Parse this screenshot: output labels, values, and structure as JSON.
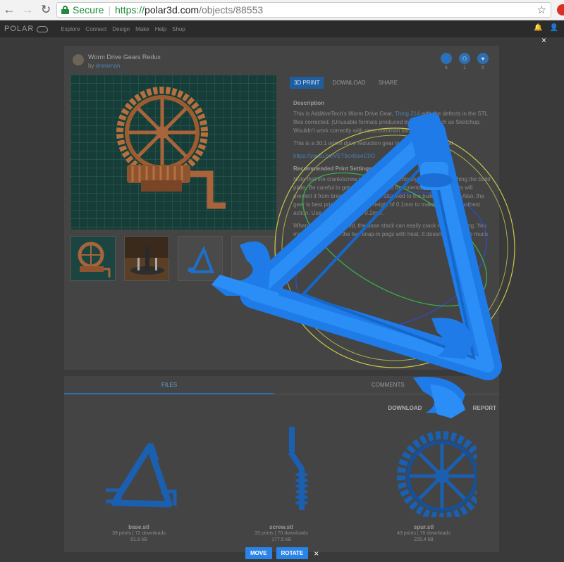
{
  "browser": {
    "back": "←",
    "forward": "→",
    "reload": "↻",
    "secure_label": "Secure",
    "url_scheme": "https://",
    "url_host": "polar3d.com",
    "url_path": "/objects/88553",
    "star": "☆"
  },
  "site": {
    "logo_text": "POLAR",
    "nav": [
      "Explore",
      "Connect",
      "Design",
      "Make",
      "Help",
      "Shop"
    ],
    "bell": "🔔",
    "user": "👤"
  },
  "overlay_close": "×",
  "object": {
    "title": "Worm Drive Gears Redux",
    "by_label": "by ",
    "author": "dnewman",
    "stats": [
      {
        "icon": "👤",
        "value": "6"
      },
      {
        "icon": "⚇",
        "value": "1"
      },
      {
        "icon": "♥",
        "value": "5"
      }
    ],
    "tabs": [
      "3D PRINT",
      "DOWNLOAD",
      "SHARE"
    ],
    "description_heading": "Description",
    "description_p1_a": "This is AdditiveTech's Worm Drive Gear, ",
    "description_p1_link": "Thing 214",
    "description_p1_b": " with the defects in the STL files corrected. (Unusable formats produced by software such as Sketchup. Wouldn't work correctly with most common slicers.)",
    "description_p2": "This is a 30:1 worm drive reduction gear in three parts. Practical",
    "description_link": "https://youtu.be/VETbcxlbseC0O",
    "rec_heading": "Recommended Print Settings",
    "rec_p1": "Note that the crank/screw is best printed vertically. Use a raft touching the build plate. Be careful to get a good bond and the orientation of the layers will prevent it from breaking. Make sure attached to the build plate well. Also, the gear is best printed with a layer height of 0.1mm to make for the smoothest action. Use a layer height of 0.2mm.",
    "rec_p2": "When the gear is printed, the base stack can easily crack when inserting. You may want to soften the two snap-in pegs with heat. It doesn't need to be much hotter than..."
  },
  "files": {
    "tab_files": "FILES",
    "tab_comments": "COMMENTS",
    "download_label": "DOWNLOAD",
    "report_label": "REPORT",
    "items": [
      {
        "name": "base.stl",
        "meta1": "39 prints | 72 downloads",
        "meta2": "61.8 kB"
      },
      {
        "name": "screw.stl",
        "meta1": "33 prints | 70 downloads",
        "meta2": "177.5 kB"
      },
      {
        "name": "spur.stl",
        "meta1": "43 prints | 70 downloads",
        "meta2": "225.4 kB"
      }
    ]
  },
  "controls": {
    "move": "MOVE",
    "rotate": "ROTATE",
    "close": "×"
  },
  "colors": {
    "model_blue": "#1e7be8",
    "accent_blue": "#2a84e8"
  }
}
